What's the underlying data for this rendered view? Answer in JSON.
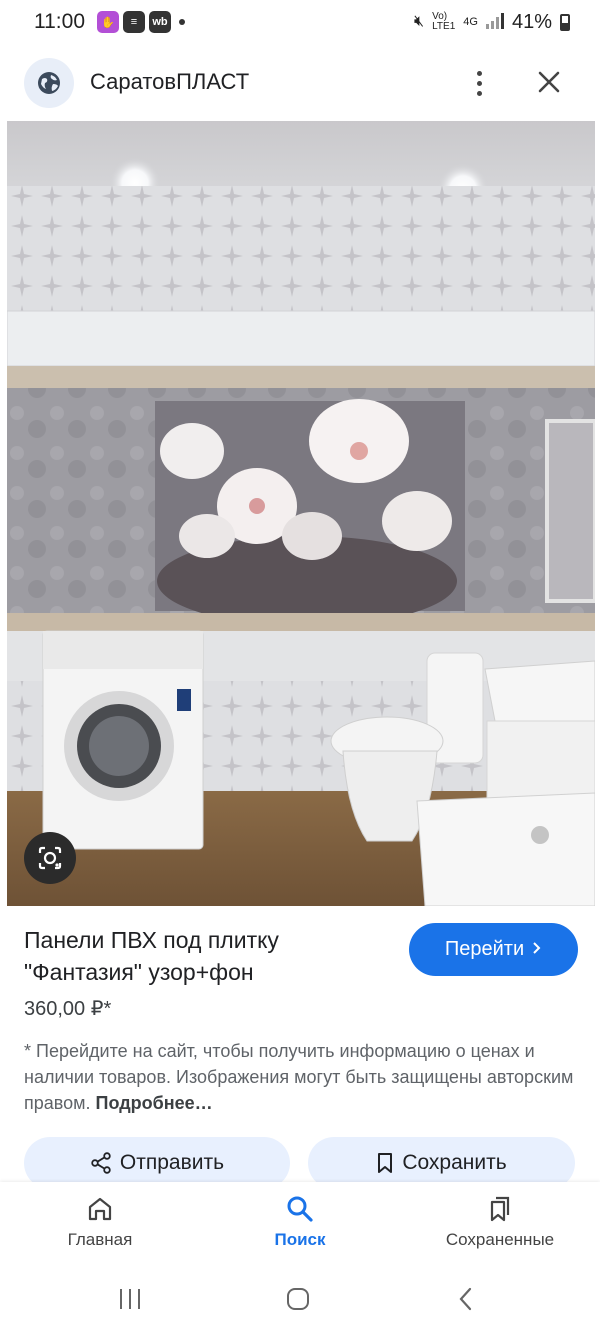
{
  "status_bar": {
    "time": "11:00",
    "network_top": "Vo)",
    "network_bottom": "LTE1",
    "signal_label": "4G",
    "battery": "41%"
  },
  "header": {
    "site_name": "СаратовПЛАСТ"
  },
  "product": {
    "title_line1": "Панели ПВХ под плитку",
    "title_line2": "\"Фантазия\" узор+фон",
    "price": "360,00 ₽*",
    "go_button": "Перейти",
    "disclaimer": "* Перейдите на сайт, чтобы получить информацию о ценах и наличии товаров. Изображения могут быть защищены авторским правом.",
    "more_link": "Подробнее…"
  },
  "actions": {
    "share": "Отправить",
    "save": "Сохранить"
  },
  "bottom_nav": {
    "home": "Главная",
    "search": "Поиск",
    "saved": "Сохраненные"
  },
  "colors": {
    "accent": "#1a73e8",
    "chip_bg": "#e8f0fe"
  }
}
